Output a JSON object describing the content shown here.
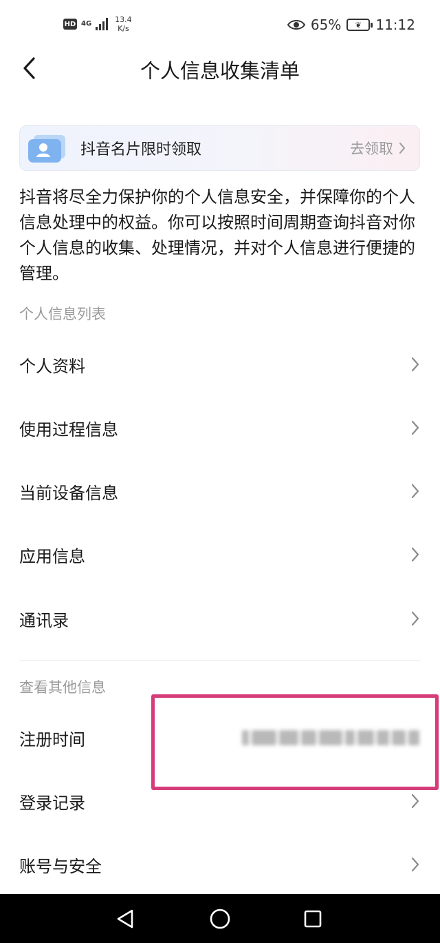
{
  "status_bar": {
    "hd": "HD",
    "network": "4G",
    "speed_value": "13.4",
    "speed_unit": "K/s",
    "battery": "65%",
    "time": "11:12"
  },
  "header": {
    "title": "个人信息收集清单"
  },
  "promo": {
    "label": "抖音名片限时领取",
    "action": "去领取"
  },
  "description": "抖音将尽全力保护你的个人信息安全，并保障你的个人信息处理中的权益。你可以按照时间周期查询抖音对你个人信息的收集、处理情况，并对个人信息进行便捷的管理。",
  "section_personal": {
    "label": "个人信息列表",
    "items": [
      {
        "label": "个人资料"
      },
      {
        "label": "使用过程信息"
      },
      {
        "label": "当前设备信息"
      },
      {
        "label": "应用信息"
      },
      {
        "label": "通讯录"
      }
    ]
  },
  "section_other": {
    "label": "查看其他信息",
    "items": [
      {
        "label": "注册时间"
      },
      {
        "label": "登录记录"
      },
      {
        "label": "账号与安全"
      }
    ]
  },
  "colors": {
    "highlight": "#d63c79",
    "secondary_text": "#9a9a9a",
    "promo_icon": "#7fb3f0"
  }
}
